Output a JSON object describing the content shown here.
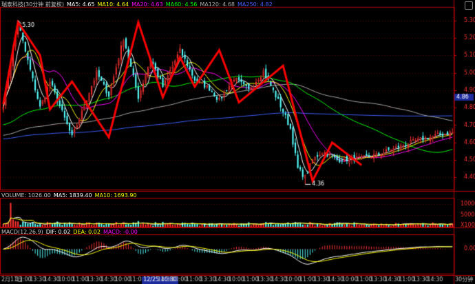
{
  "header": {
    "title": "瑞泰科技(30分钟 前复权)",
    "ma5": "MA5: 4.65",
    "ma10": "MA10: 4.64",
    "ma20": "MA20: 4.63",
    "ma60": "MA60: 4.56",
    "ma120": "MA120: 4.68",
    "ma250": "MA250: 4.82"
  },
  "volume_header": {
    "label": "VOLUME: 1026.00",
    "ma5": "MA5: 1839.40",
    "ma10": "MA10: 1693.90"
  },
  "macd_header": {
    "label": "MACD(12,26,9)",
    "dif": "DIF: 0.02",
    "dea": "DEA: 0.02",
    "macd": "MACD: -0.00"
  },
  "colors": {
    "up": "#ff3232",
    "down": "#54fcfc",
    "ma5": "#ffffff",
    "ma10": "#ffff00",
    "ma20": "#ff00ff",
    "ma60": "#00ff00",
    "ma120": "#aaaaaa",
    "ma250": "#4060ff",
    "axis": "#c00000",
    "grid": "#5a0000",
    "text": "#c0c0c0",
    "zigzag": "#ff0000"
  },
  "chart_data": {
    "type": "candlestick",
    "price_axis": {
      "ticks": [
        "5.30",
        "5.20",
        "5.10",
        "5.00",
        "4.90",
        "4.80",
        "4.70",
        "4.60",
        "4.50",
        "4.40"
      ],
      "ylim": [
        4.33,
        5.37
      ],
      "current_price": "4.86"
    },
    "volume_axis": {
      "ticks": [
        "10000",
        "5000",
        "X100"
      ],
      "ylim": [
        0,
        12000
      ]
    },
    "macd_axis": {
      "ticks": [
        "0.00"
      ],
      "ylim": [
        -0.22,
        0.12
      ]
    },
    "annotations": {
      "high": "5.30",
      "low": "4.36"
    },
    "x_tick_labels": [
      "2月11日",
      "11:00",
      "13:30",
      "14:30",
      "10:00",
      "11:00",
      "13:30",
      "14:30",
      "10:00",
      "11:00",
      "12/25 10:30",
      "14:30",
      "10:00",
      "11:00",
      "13:30",
      "14:30",
      "10:00",
      "11:00",
      "13:30",
      "14:30",
      "10:00",
      "11:00",
      "13:30",
      "14:30",
      "10:00",
      "11:00",
      "13:30",
      "14:30",
      "11:00",
      "13:30",
      "14:30"
    ],
    "x_unit": "30分钟",
    "zigzag_prices": [
      4.82,
      5.29,
      5.1,
      4.79,
      4.95,
      4.63,
      5.29,
      4.86,
      5.09,
      4.92,
      5.13,
      4.83,
      5.04,
      4.38,
      4.6,
      4.47
    ]
  },
  "zigzag_indices": [
    0,
    6,
    15,
    19,
    28,
    43,
    55,
    65,
    72,
    78,
    88,
    96,
    114,
    126,
    134,
    146
  ],
  "price_path": [
    [
      0,
      4.82
    ],
    [
      6,
      5.29
    ],
    [
      9,
      5.12
    ],
    [
      15,
      4.8
    ],
    [
      19,
      4.95
    ],
    [
      28,
      4.63
    ],
    [
      38,
      5.0
    ],
    [
      43,
      4.87
    ],
    [
      49,
      5.2
    ],
    [
      55,
      4.86
    ],
    [
      60,
      5.08
    ],
    [
      65,
      4.92
    ],
    [
      72,
      5.13
    ],
    [
      78,
      4.96
    ],
    [
      84,
      4.91
    ],
    [
      88,
      4.84
    ],
    [
      94,
      4.97
    ],
    [
      100,
      4.9
    ],
    [
      106,
      5.01
    ],
    [
      113,
      4.81
    ],
    [
      117,
      4.68
    ],
    [
      120,
      4.45
    ],
    [
      123,
      4.4
    ],
    [
      126,
      4.5
    ],
    [
      130,
      4.55
    ],
    [
      136,
      4.5
    ],
    [
      146,
      4.51
    ],
    [
      152,
      4.53
    ],
    [
      160,
      4.57
    ],
    [
      168,
      4.61
    ],
    [
      176,
      4.64
    ],
    [
      183,
      4.66
    ]
  ]
}
